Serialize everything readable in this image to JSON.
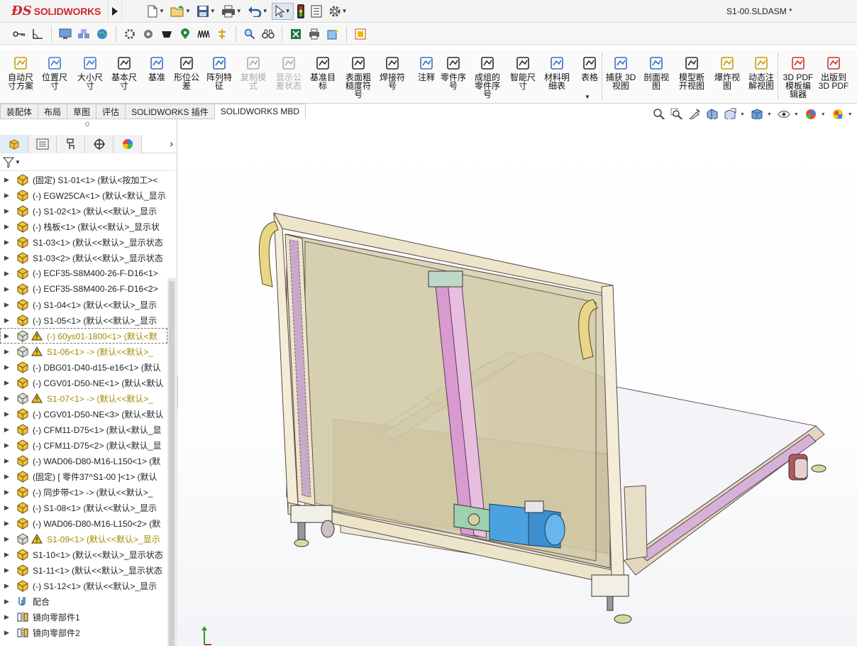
{
  "app": {
    "brand": "SOLIDWORKS",
    "document_title": "S1-00.SLDASM *"
  },
  "command_manager": {
    "items": [
      {
        "label": "自动尺\n寸方案",
        "icon": "auto-dimension-icon",
        "enabled": true
      },
      {
        "label": "位置尺\n寸",
        "icon": "location-dimension-icon",
        "enabled": true
      },
      {
        "label": "大小尺\n寸",
        "icon": "size-dimension-icon",
        "enabled": true
      },
      {
        "label": "基本尺\n寸",
        "icon": "basic-dimension-icon",
        "enabled": true
      },
      {
        "label": "基准",
        "icon": "datum-icon",
        "enabled": true
      },
      {
        "label": "形位公\n差",
        "icon": "geometric-tolerance-icon",
        "enabled": true
      },
      {
        "label": "阵列特\n征",
        "icon": "pattern-feature-icon",
        "enabled": true
      },
      {
        "label": "复制模\n式",
        "icon": "copy-scheme-icon",
        "enabled": false
      },
      {
        "label": "显示公\n差状态",
        "icon": "show-tolerance-status-icon",
        "enabled": false
      },
      {
        "label": "基准目\n标",
        "icon": "datum-target-icon",
        "enabled": true
      },
      {
        "label": "表面粗\n糙度符\n号",
        "icon": "surface-finish-icon",
        "enabled": true
      },
      {
        "label": "焊接符\n号",
        "icon": "weld-symbol-icon",
        "enabled": true
      },
      {
        "label": "注释",
        "icon": "note-icon",
        "enabled": true
      },
      {
        "label": "零件序\n号",
        "icon": "balloon-icon",
        "enabled": true
      },
      {
        "label": "成组的\n零件序\n号",
        "icon": "stacked-balloon-icon",
        "enabled": true
      },
      {
        "label": "智能尺\n寸",
        "icon": "smart-dimension-icon",
        "enabled": true
      },
      {
        "label": "材料明\n细表",
        "icon": "bom-icon",
        "enabled": true
      },
      {
        "label": "表格",
        "icon": "table-icon",
        "enabled": true
      },
      {
        "label": "捕获 3D\n视图",
        "icon": "capture-3d-view-icon",
        "enabled": true
      },
      {
        "label": "剖面视\n图",
        "icon": "section-view-icon",
        "enabled": true
      },
      {
        "label": "模型断\n开视图",
        "icon": "model-break-view-icon",
        "enabled": true
      },
      {
        "label": "爆炸视\n图",
        "icon": "exploded-view-icon",
        "enabled": true
      },
      {
        "label": "动态注\n解视图",
        "icon": "dynamic-annotation-view-icon",
        "enabled": true
      },
      {
        "label": "3D PDF\n模板编\n辑器",
        "icon": "3d-pdf-template-icon",
        "enabled": true
      },
      {
        "label": "出版到\n3D PDF",
        "icon": "publish-3d-pdf-icon",
        "enabled": true
      }
    ]
  },
  "tabs": [
    {
      "label": "装配体",
      "active": false
    },
    {
      "label": "布局",
      "active": false
    },
    {
      "label": "草图",
      "active": false
    },
    {
      "label": "评估",
      "active": false
    },
    {
      "label": "SOLIDWORKS 插件",
      "active": false
    },
    {
      "label": "SOLIDWORKS MBD",
      "active": true
    }
  ],
  "tree": {
    "items": [
      {
        "text": "(固定) S1-01<1> (默认<按加工><",
        "warn": false
      },
      {
        "text": "(-) EGW25CA<1> (默认<默认_显示",
        "warn": false
      },
      {
        "text": "(-) S1-02<1> (默认<<默认>_显示",
        "warn": false
      },
      {
        "text": "(-) 栈板<1> (默认<<默认>_显示状",
        "warn": false
      },
      {
        "text": "S1-03<1> (默认<<默认>_显示状态",
        "warn": false
      },
      {
        "text": "S1-03<2> (默认<<默认>_显示状态",
        "warn": false
      },
      {
        "text": "(-) ECF35-S8M400-26-F-D16<1>",
        "warn": false
      },
      {
        "text": "(-) ECF35-S8M400-26-F-D16<2>",
        "warn": false
      },
      {
        "text": "(-) S1-04<1> (默认<<默认>_显示",
        "warn": false
      },
      {
        "text": "(-) S1-05<1> (默认<<默认>_显示",
        "warn": false
      },
      {
        "text": "(-) 60ys01-1800<1> (默认<默",
        "warn": true,
        "selected": true
      },
      {
        "text": "S1-06<1> -> (默认<<默认>_",
        "warn": true
      },
      {
        "text": "(-) DBG01-D40-d15-e16<1> (默认",
        "warn": false
      },
      {
        "text": "(-) CGV01-D50-NE<1> (默认<默认",
        "warn": false
      },
      {
        "text": "S1-07<1> -> (默认<<默认>_",
        "warn": true
      },
      {
        "text": "(-) CGV01-D50-NE<3> (默认<默认",
        "warn": false
      },
      {
        "text": "(-) CFM11-D75<1> (默认<默认_显",
        "warn": false
      },
      {
        "text": "(-) CFM11-D75<2> (默认<默认_显",
        "warn": false
      },
      {
        "text": "(-) WAD06-D80-M16-L150<1> (默",
        "warn": false
      },
      {
        "text": "(固定) [ 零件37^S1-00 ]<1> (默认",
        "warn": false
      },
      {
        "text": "(-) 同步带<1> -> (默认<<默认>_",
        "warn": false
      },
      {
        "text": "(-) S1-08<1> (默认<<默认>_显示",
        "warn": false
      },
      {
        "text": "(-) WAD06-D80-M16-L150<2> (默",
        "warn": false
      },
      {
        "text": "S1-09<1> (默认<<默认>_显示",
        "warn": true
      },
      {
        "text": "S1-10<1> (默认<<默认>_显示状态",
        "warn": false
      },
      {
        "text": "S1-11<1> (默认<<默认>_显示状态",
        "warn": false
      },
      {
        "text": "(-) S1-12<1> (默认<<默认>_显示",
        "warn": false
      },
      {
        "text": "配合",
        "warn": false,
        "kind": "mates"
      },
      {
        "text": "镜向零部件1",
        "warn": false,
        "kind": "mirror"
      },
      {
        "text": "镜向零部件2",
        "warn": false,
        "kind": "mirror"
      }
    ]
  },
  "colors": {
    "frame": "#ede5c9",
    "frame_edge": "#5a4a4a",
    "glass": "#cdc6a4",
    "belt": "#d99ad0",
    "motor": "#4aa3e0",
    "warning": "#f2c200",
    "brand": "#d0252d"
  }
}
